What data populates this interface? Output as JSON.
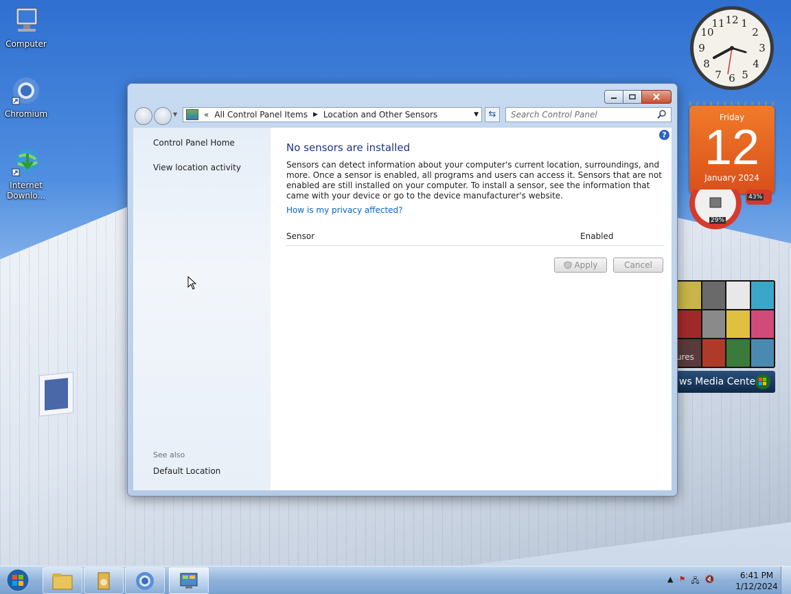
{
  "desktop": {
    "icons": [
      {
        "label": "Computer"
      },
      {
        "label": "Chromium"
      },
      {
        "label": "Internet Downlo..."
      }
    ]
  },
  "gadgets": {
    "calendar": {
      "weekday": "Friday",
      "day": "12",
      "month_year": "January 2024"
    },
    "meter": {
      "cpu_label": "29%",
      "mem_label": "43%"
    },
    "media_center": {
      "label": "ws Media Center",
      "tile_label": "ures"
    }
  },
  "window": {
    "nav": {
      "breadcrumb_prefix": "«",
      "breadcrumb": [
        "All Control Panel Items",
        "Location and Other Sensors"
      ],
      "search_placeholder": "Search Control Panel"
    },
    "sidebar": {
      "home": "Control Panel Home",
      "links": [
        "View location activity"
      ],
      "see_also_header": "See also",
      "see_also": [
        "Default Location"
      ]
    },
    "main": {
      "title": "No sensors are installed",
      "description": "Sensors can detect information about your computer's current location, surroundings, and more. Once a sensor is enabled, all programs and users can access it. Sensors that are not enabled are still installed on your computer. To install a sensor, see the information that came with your device or go to the device manufacturer's website.",
      "privacy_link": "How is my privacy affected?",
      "columns": [
        "Sensor",
        "Enabled"
      ],
      "apply": "Apply",
      "cancel": "Cancel"
    }
  },
  "taskbar": {
    "time": "6:41 PM",
    "date": "1/12/2024"
  }
}
